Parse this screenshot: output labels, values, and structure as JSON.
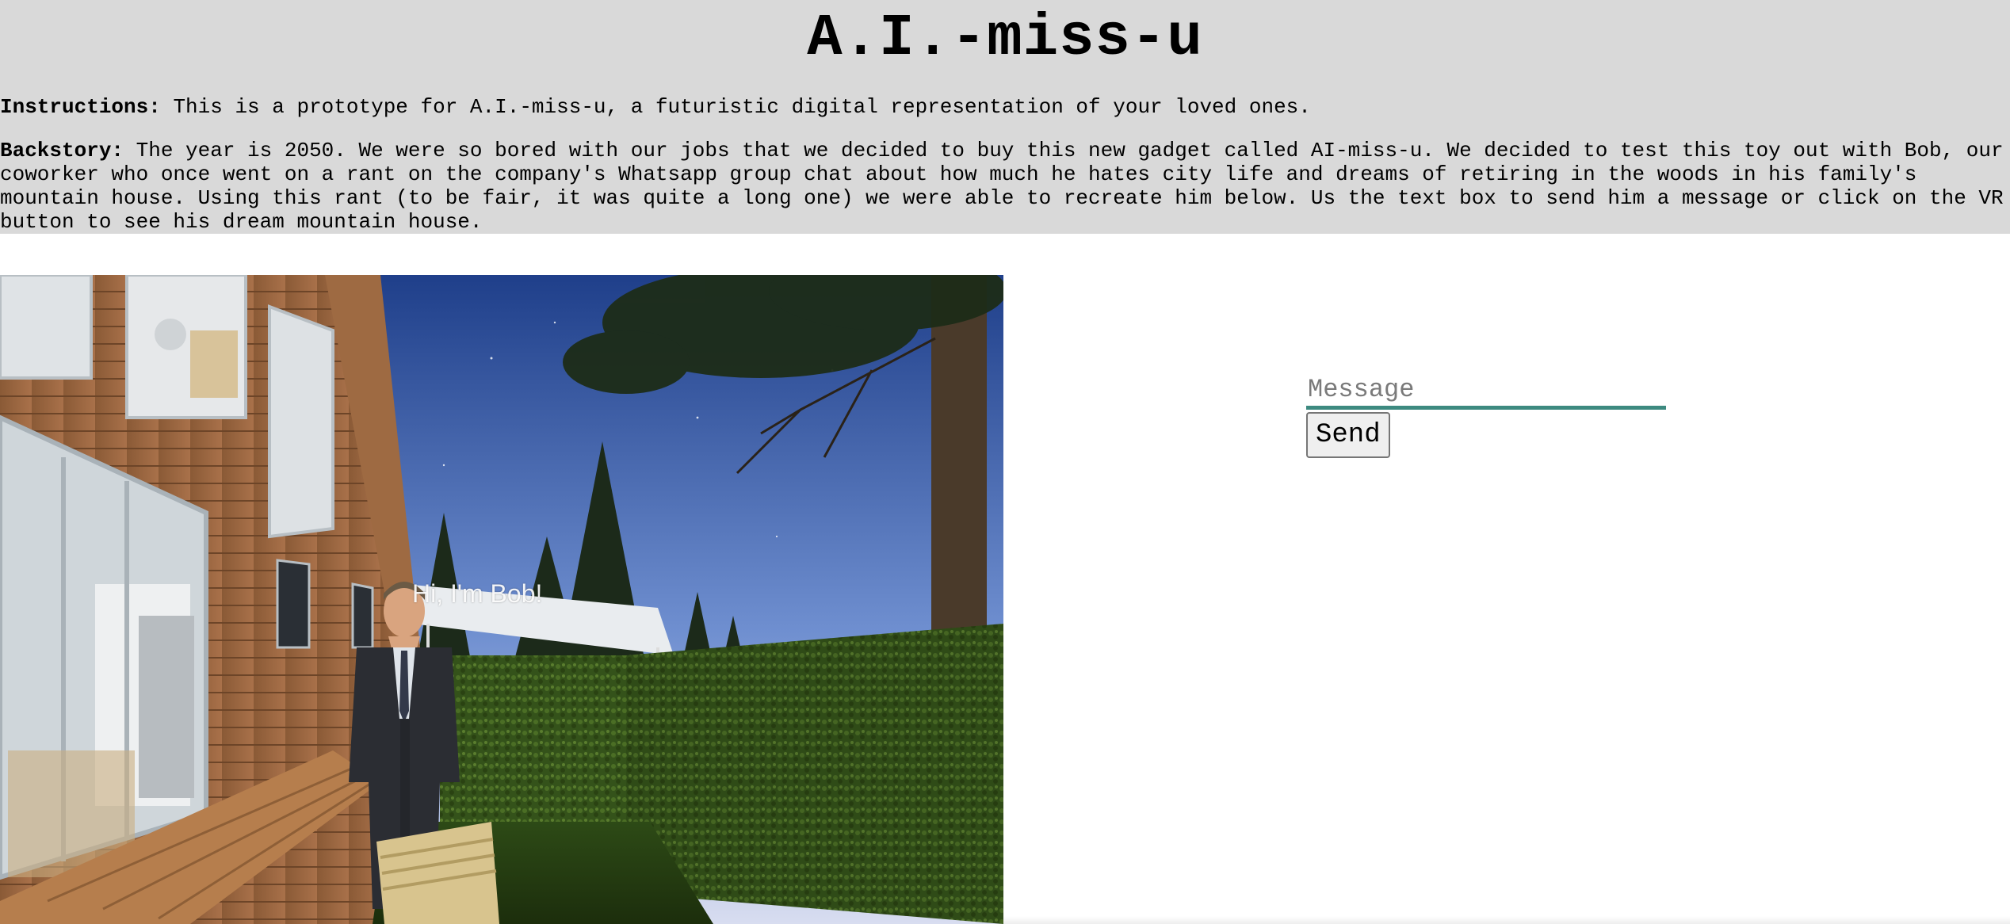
{
  "header": {
    "title": "A.I.-miss-u",
    "instructions_label": "Instructions:",
    "instructions_text": " This is a prototype for A.I.-miss-u, a futuristic digital representation of your loved ones.",
    "backstory_label": "Backstory:",
    "backstory_text": " The year is 2050. We were so bored with our jobs that we decided to buy this new gadget called AI-miss-u. We decided to test this toy out with Bob, our coworker who once went on a rant on the company's Whatsapp group chat about how much he hates city life and dreams of retiring in the woods in his family's mountain house. Using this rant (to be fair, it was quite a long one) we were able to recreate him below. Us the text box to send him a message or click on the VR button to see his dream mountain house."
  },
  "scene": {
    "bob_label": "Hi, I'm Bob!"
  },
  "chat": {
    "message_placeholder": "Message",
    "message_value": "",
    "send_label": "Send"
  },
  "colors": {
    "header_bg": "#d9d9d9",
    "input_underline": "#3d8a80"
  }
}
